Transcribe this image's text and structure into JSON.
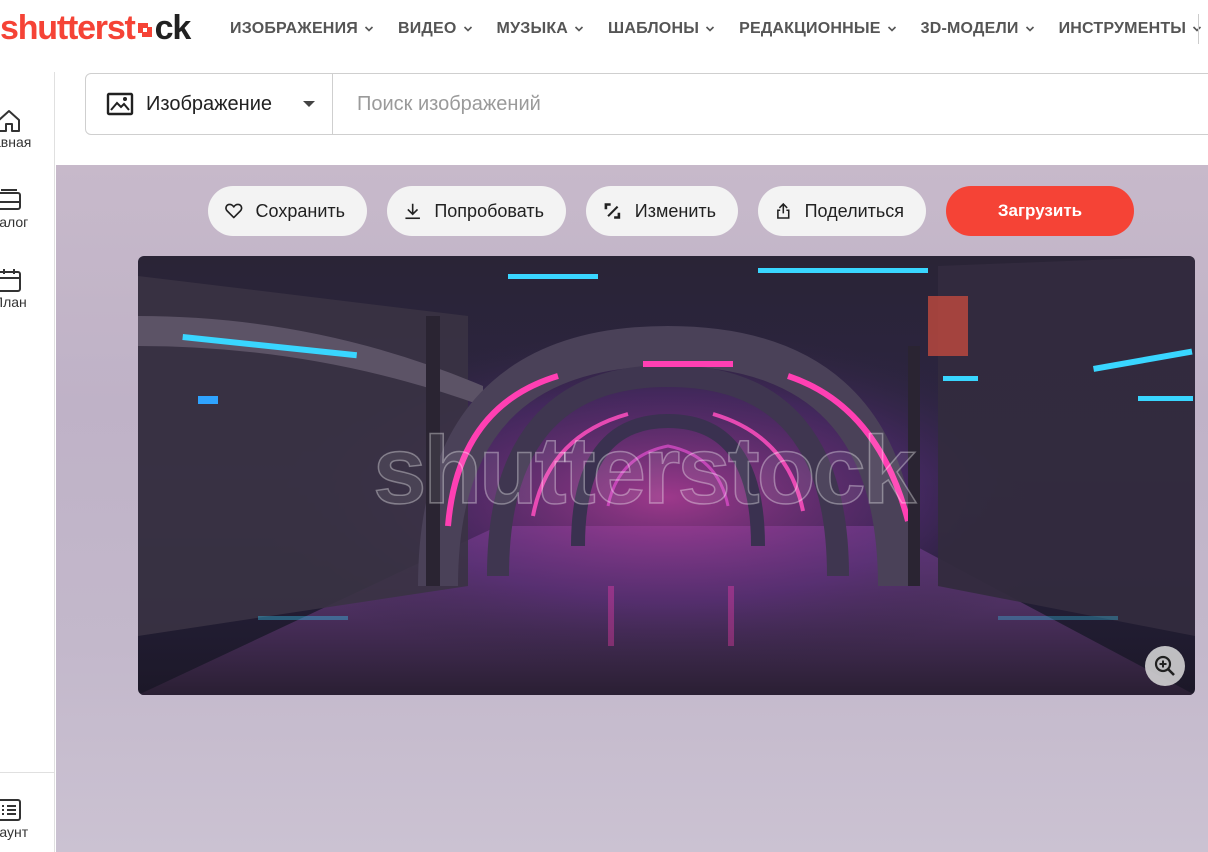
{
  "brand": {
    "logo_part1": "shutterst",
    "logo_part2": "ck"
  },
  "nav": {
    "items": [
      {
        "label": "ИЗОБРАЖЕНИЯ"
      },
      {
        "label": "ВИДЕО"
      },
      {
        "label": "МУЗЫКА"
      },
      {
        "label": "ШАБЛОНЫ"
      },
      {
        "label": "РЕДАКЦИОННЫЕ"
      },
      {
        "label": "3D-МОДЕЛИ"
      },
      {
        "label": "ИНСТРУМЕНТЫ"
      }
    ]
  },
  "sidebar": {
    "items": [
      {
        "label": "авная",
        "icon": "home-icon"
      },
      {
        "label": "талог",
        "icon": "catalog-icon"
      },
      {
        "label": "План",
        "icon": "calendar-icon"
      }
    ],
    "bottom": {
      "label": "каунт",
      "icon": "account-icon"
    }
  },
  "search": {
    "type_label": "Изображение",
    "placeholder": "Поиск изображений",
    "value": ""
  },
  "actions": {
    "save": "Сохранить",
    "try": "Попробовать",
    "edit": "Изменить",
    "share": "Поделиться",
    "upload": "Загрузить"
  },
  "preview": {
    "watermark": "shutterstock"
  },
  "colors": {
    "brand_red": "#f54336",
    "neon_pink": "#ff3fb3",
    "neon_cyan": "#29d3ff"
  }
}
